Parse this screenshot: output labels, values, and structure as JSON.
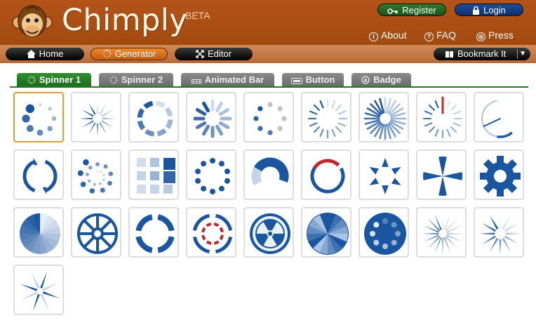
{
  "header": {
    "brand": "Chimply",
    "beta": "BETA",
    "register_label": "Register",
    "login_label": "Login",
    "links": [
      {
        "label": "About",
        "icon": "info-icon"
      },
      {
        "label": "FAQ",
        "icon": "question-icon"
      },
      {
        "label": "Press",
        "icon": "press-icon"
      }
    ]
  },
  "nav": {
    "home_label": "Home",
    "generator_label": "Generator",
    "editor_label": "Editor",
    "bookmark_label": "Bookmark It"
  },
  "tabs": [
    {
      "label": "Spinner 1",
      "active": true
    },
    {
      "label": "Spinner 2",
      "active": false
    },
    {
      "label": "Animated Bar",
      "active": false
    },
    {
      "label": "Button",
      "active": false
    },
    {
      "label": "Badge",
      "active": false
    }
  ],
  "colors": {
    "header_bg": "#a84e12",
    "active_tab": "#248524",
    "spinner_blue": "#1a55a0",
    "accent_red": "#c0282a",
    "selected_border": "#e09b3a"
  },
  "spinners": [
    {
      "name": "dots-circle-spinner",
      "selected": true
    },
    {
      "name": "star-wedges-spinner"
    },
    {
      "name": "dashed-ring-spinner"
    },
    {
      "name": "petals-spinner"
    },
    {
      "name": "dots-gray-spinner"
    },
    {
      "name": "thin-lines-spinner"
    },
    {
      "name": "dense-lines-spinner"
    },
    {
      "name": "lines-red-hand-spinner"
    },
    {
      "name": "arc-sweep-spinner"
    },
    {
      "name": "refresh-arrows-spinner"
    },
    {
      "name": "spiral-dots-spinner"
    },
    {
      "name": "square-blocks-spinner"
    },
    {
      "name": "ring-dots-spinner"
    },
    {
      "name": "thick-arc-spinner"
    },
    {
      "name": "red-arc-spinner"
    },
    {
      "name": "triangles-spinner"
    },
    {
      "name": "pinwheel-blades-spinner"
    },
    {
      "name": "gear-spinner"
    },
    {
      "name": "fan-wedges-spinner"
    },
    {
      "name": "wheel-spokes-spinner"
    },
    {
      "name": "segmented-ring-spinner"
    },
    {
      "name": "target-ring-spinner"
    },
    {
      "name": "radiation-spinner"
    },
    {
      "name": "shaded-pie-spinner"
    },
    {
      "name": "dotted-disc-spinner"
    },
    {
      "name": "fan-petals-spinner"
    },
    {
      "name": "light-fan-spinner"
    },
    {
      "name": "pinwheel-spinner"
    }
  ]
}
